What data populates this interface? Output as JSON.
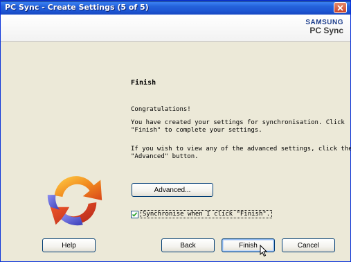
{
  "window": {
    "title": "PC Sync - Create Settings (5 of 5)"
  },
  "brand": {
    "company": "SAMSUNG",
    "product": "PC Sync"
  },
  "main": {
    "heading": "Finish",
    "congrats": "Congratulations!",
    "para1_line1": "You have created your settings for synchronisation. Click",
    "para1_line2": "\"Finish\" to complete your settings.",
    "para2_line1": "If you wish to view any of the advanced settings, click the",
    "para2_line2": "\"Advanced\" button.",
    "advanced_label": "Advanced...",
    "checkbox_label": "Synchronise when I click \"Finish\".",
    "checkbox_checked": true
  },
  "footer": {
    "help_label": "Help",
    "back_label": "Back",
    "finish_label": "Finish",
    "cancel_label": "Cancel"
  },
  "icons": {
    "close": "close-icon",
    "logo": "sync-arrows-logo",
    "cursor": "mouse-pointer-icon",
    "check": "checkmark-icon"
  },
  "colors": {
    "titlebar": "#2563DB",
    "dialog_bg": "#ECE9D8",
    "button_border": "#003C74",
    "logo_orange": "#F28C1E",
    "logo_blue": "#5C5FD9"
  }
}
